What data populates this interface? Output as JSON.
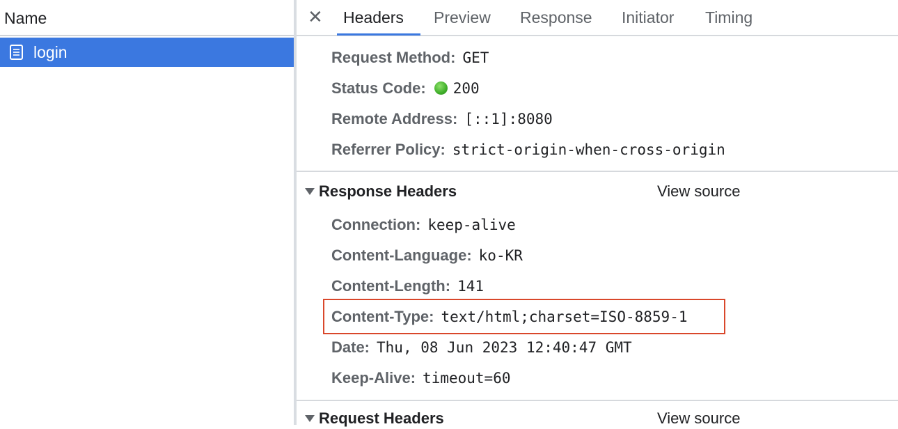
{
  "left_panel": {
    "column_header": "Name",
    "requests": [
      {
        "name": "login",
        "icon": "document-icon"
      }
    ]
  },
  "tabs": {
    "close_icon": "close-icon",
    "items": [
      "Headers",
      "Preview",
      "Response",
      "Initiator",
      "Timing"
    ],
    "active": "Headers"
  },
  "general": [
    {
      "key": "Request Method:",
      "value": "GET"
    },
    {
      "key": "Status Code:",
      "value": "200",
      "status_color": "#3fae2a"
    },
    {
      "key": "Remote Address:",
      "value": "[::1]:8080"
    },
    {
      "key": "Referrer Policy:",
      "value": "strict-origin-when-cross-origin"
    }
  ],
  "response_headers": {
    "title": "Response Headers",
    "view_source": "View source",
    "items": [
      {
        "key": "Connection:",
        "value": "keep-alive"
      },
      {
        "key": "Content-Language:",
        "value": "ko-KR"
      },
      {
        "key": "Content-Length:",
        "value": "141"
      },
      {
        "key": "Content-Type:",
        "value": "text/html;charset=ISO-8859-1",
        "highlighted": true
      },
      {
        "key": "Date:",
        "value": "Thu, 08 Jun 2023 12:40:47 GMT"
      },
      {
        "key": "Keep-Alive:",
        "value": "timeout=60"
      }
    ]
  },
  "request_headers": {
    "title": "Request Headers",
    "view_source": "View source"
  },
  "colors": {
    "accent": "#3b78e0",
    "highlight_border": "#d9472b"
  }
}
